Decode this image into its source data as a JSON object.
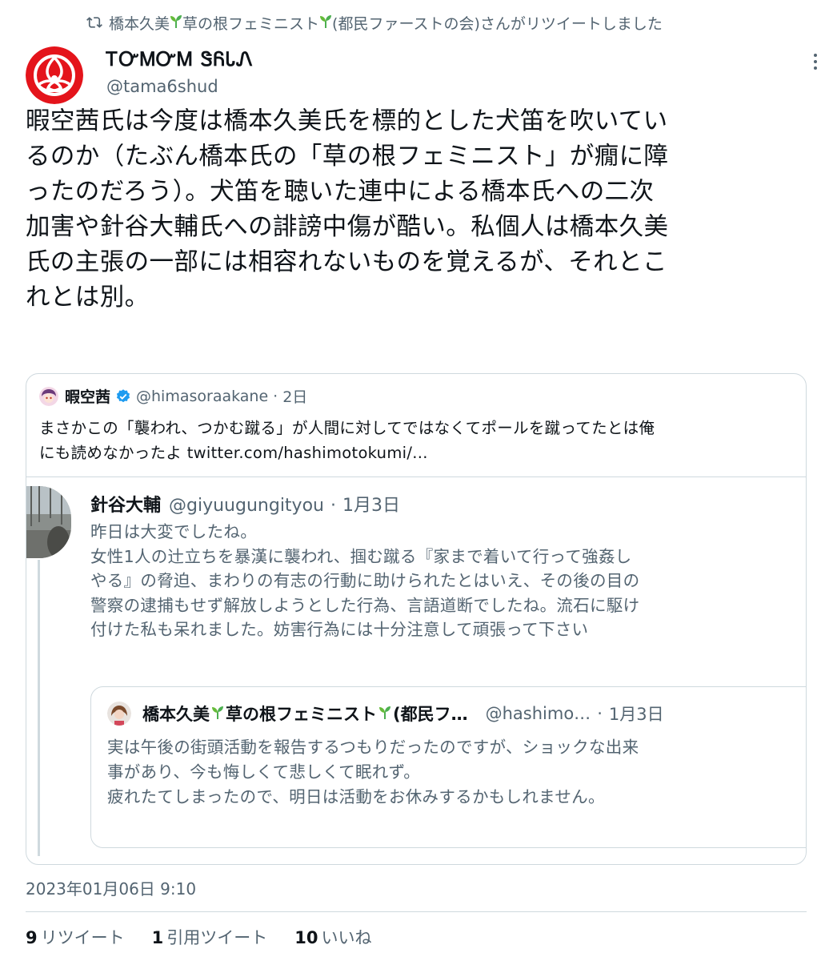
{
  "retweet_notice": {
    "text_a": "橋本久美",
    "text_b": "草の根フェミニスト",
    "text_c": "(都民ファーストの会)さんがリツイートしました"
  },
  "tweet": {
    "author_name": "ᎢᏅᎷᏅᎷ ᏕᏲᏓᏁ",
    "author_handle": "@tama6shud",
    "body_lines": [
      "暇空茜氏は今度は橋本久美氏を標的とした犬笛を吹いてい",
      "るのか（たぶん橋本氏の「草の根フェミニスト」が癇に障",
      "ったのだろう）。犬笛を聴いた連中による橋本氏への二次",
      "加害や針谷大輔氏への誹謗中傷が酷い。私個人は橋本久美",
      "氏の主張の一部には相容れないものを覚えるが、それとこ",
      "れとは別。"
    ],
    "timestamp": "2023年01月06日 9:10",
    "stats": {
      "retweets": "9",
      "retweets_label": "リツイート",
      "quotes": "1",
      "quotes_label": "引用ツイート",
      "likes": "10",
      "likes_label": "いいね"
    }
  },
  "quote1": {
    "name": "暇空茜",
    "handle": "@himasoraakane",
    "sep": "·",
    "time": "2日",
    "lines": [
      "まさかこの「襲われ、つかむ蹴る」が人間に対してではなくてポールを蹴ってたとは俺",
      "にも読めなかったよ twitter.com/hashimotokumi/..."
    ]
  },
  "quote2": {
    "name": "針谷大輔",
    "handle": "@giyuugungityou",
    "sep": "·",
    "time": "1月3日",
    "lines": [
      "昨日は大変でしたね。",
      "女性1人の辻立ちを暴漢に襲われ、掴む蹴る『家まで着いて行って強姦し",
      "やる』の脅迫、まわりの有志の行動に助けられたとはいえ、その後の目の",
      "警察の逮捕もせず解放しようとした行為、言語道断でしたね。流石に駆け",
      "付けた私も呆れました。妨害行為には十分注意して頑張って下さい"
    ]
  },
  "quote3": {
    "name_a": "橋本久美",
    "name_b": "草の根フェミニスト",
    "name_c": "(都民フ…",
    "handle": "@hashimo…",
    "sep": "·",
    "time": "1月3日",
    "lines": [
      "実は午後の街頭活動を報告するつもりだったのですが、ショックな出来",
      "事があり、今も悔しくて悲しくて眠れず。",
      "疲れたてしまったので、明日は活動をお休みするかもしれません。"
    ]
  },
  "colors": {
    "text_primary": "#0f1419",
    "text_secondary": "#536471",
    "border": "#cfd9de",
    "verified_blue": "#1d9bf0",
    "sprout_green": "#4caf50",
    "avatar_red": "#e4141b"
  },
  "icons": [
    "retweet-icon",
    "sprout-icon",
    "more-icon",
    "verified-icon"
  ]
}
